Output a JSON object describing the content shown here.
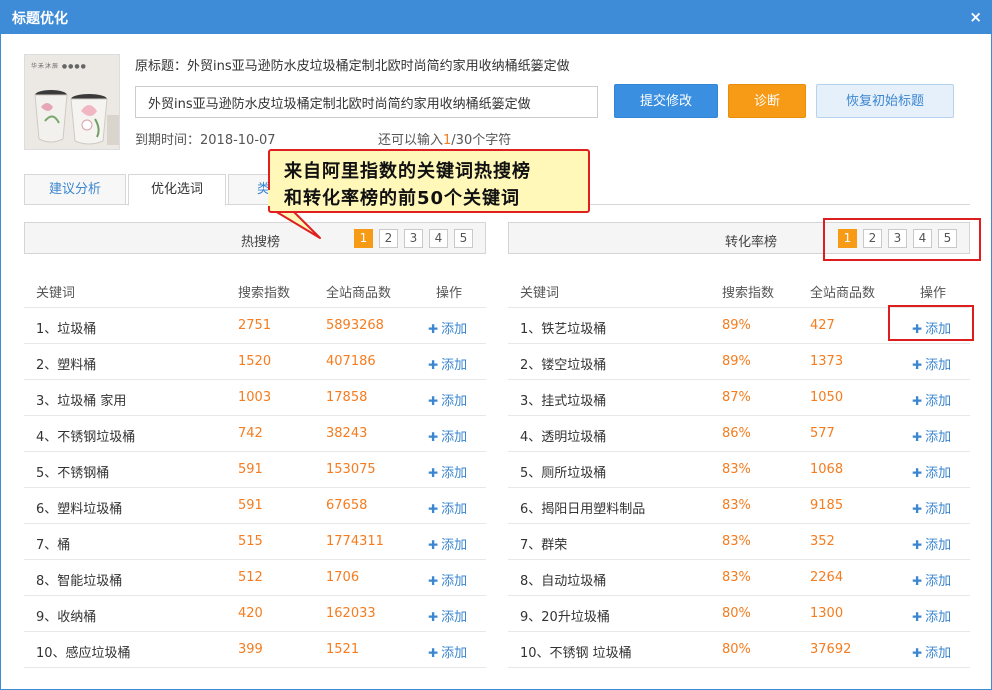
{
  "window": {
    "title": "标题优化",
    "close_glyph": "×"
  },
  "product": {
    "thumb_brand": "华禾沐辰 ●●●●",
    "original_label": "原标题：",
    "original_title": "外贸ins亚马逊防水皮垃圾桶定制北欧时尚简约家用收纳桶纸篓定做",
    "input_value": "外贸ins亚马逊防水皮垃圾桶定制北欧时尚简约家用收纳桶纸篓定做",
    "expire_label": "到期时间：",
    "expire_date": "2018-10-07",
    "remaining_prefix": "还可以输入",
    "remaining_count": "1",
    "remaining_suffix": "/30个字符"
  },
  "buttons": {
    "submit": "提交修改",
    "diagnose": "诊断",
    "reset": "恢复初始标题"
  },
  "tabs": {
    "analysis": "建议分析",
    "select": "优化选词",
    "third": "类"
  },
  "callout": {
    "line1": "来自阿里指数的关键词热搜榜",
    "line2": "和转化率榜的前50个关键词"
  },
  "hot": {
    "title": "热搜榜",
    "pages": [
      "1",
      "2",
      "3",
      "4",
      "5"
    ],
    "active_page": "1",
    "headers": {
      "keyword": "关键词",
      "index": "搜索指数",
      "count": "全站商品数",
      "op": "操作"
    },
    "rows": [
      {
        "kw": "1、垃圾桶",
        "index": "2751",
        "count": "5893268",
        "op": "添加"
      },
      {
        "kw": "2、塑料桶",
        "index": "1520",
        "count": "407186",
        "op": "添加"
      },
      {
        "kw": "3、垃圾桶 家用",
        "index": "1003",
        "count": "17858",
        "op": "添加"
      },
      {
        "kw": "4、不锈钢垃圾桶",
        "index": "742",
        "count": "38243",
        "op": "添加"
      },
      {
        "kw": "5、不锈钢桶",
        "index": "591",
        "count": "153075",
        "op": "添加"
      },
      {
        "kw": "6、塑料垃圾桶",
        "index": "591",
        "count": "67658",
        "op": "添加"
      },
      {
        "kw": "7、桶",
        "index": "515",
        "count": "1774311",
        "op": "添加"
      },
      {
        "kw": "8、智能垃圾桶",
        "index": "512",
        "count": "1706",
        "op": "添加"
      },
      {
        "kw": "9、收纳桶",
        "index": "420",
        "count": "162033",
        "op": "添加"
      },
      {
        "kw": "10、感应垃圾桶",
        "index": "399",
        "count": "1521",
        "op": "添加"
      }
    ]
  },
  "conv": {
    "title": "转化率榜",
    "pages": [
      "1",
      "2",
      "3",
      "4",
      "5"
    ],
    "active_page": "1",
    "headers": {
      "keyword": "关键词",
      "index": "搜索指数",
      "count": "全站商品数",
      "op": "操作"
    },
    "rows": [
      {
        "kw": "1、铁艺垃圾桶",
        "index": "89%",
        "count": "427",
        "op": "添加"
      },
      {
        "kw": "2、镂空垃圾桶",
        "index": "89%",
        "count": "1373",
        "op": "添加"
      },
      {
        "kw": "3、挂式垃圾桶",
        "index": "87%",
        "count": "1050",
        "op": "添加"
      },
      {
        "kw": "4、透明垃圾桶",
        "index": "86%",
        "count": "577",
        "op": "添加"
      },
      {
        "kw": "5、厕所垃圾桶",
        "index": "83%",
        "count": "1068",
        "op": "添加"
      },
      {
        "kw": "6、揭阳日用塑料制品",
        "index": "83%",
        "count": "9185",
        "op": "添加"
      },
      {
        "kw": "7、群荣",
        "index": "83%",
        "count": "352",
        "op": "添加"
      },
      {
        "kw": "8、自动垃圾桶",
        "index": "83%",
        "count": "2264",
        "op": "添加"
      },
      {
        "kw": "9、20升垃圾桶",
        "index": "80%",
        "count": "1300",
        "op": "添加"
      },
      {
        "kw": "10、不锈钢 垃圾桶",
        "index": "80%",
        "count": "37692",
        "op": "添加"
      }
    ]
  },
  "colors": {
    "titlebar": "#3e8bd8",
    "primary_button": "#3b8fe0",
    "orange_button": "#f79a15",
    "number_text": "#f57c1f",
    "link_blue": "#3b86d1",
    "highlight_red": "#dc1e1e",
    "callout_fill": "#fff8b8"
  }
}
